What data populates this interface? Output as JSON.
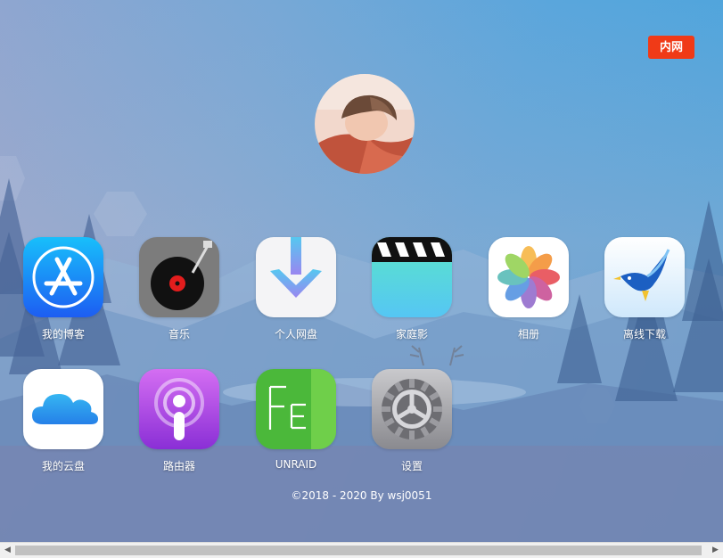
{
  "header": {
    "intranet_label": "内网"
  },
  "apps": [
    {
      "label": "我的博客",
      "icon": "app-store-icon"
    },
    {
      "label": "音乐",
      "icon": "record-player-icon"
    },
    {
      "label": "个人网盘",
      "icon": "download-arrow-icon"
    },
    {
      "label": "家庭影",
      "icon": "clapperboard-icon"
    },
    {
      "label": "相册",
      "icon": "photos-flower-icon"
    },
    {
      "label": "离线下载",
      "icon": "bird-icon"
    },
    {
      "label": "我的云盘",
      "icon": "cloud-icon"
    },
    {
      "label": "路由器",
      "icon": "podcast-icon"
    },
    {
      "label": "UNRAID",
      "icon": "fe-icon"
    },
    {
      "label": "设置",
      "icon": "gear-icon"
    }
  ],
  "footer": {
    "copyright": "©2018 - 2020 By wsj0051"
  },
  "colors": {
    "intranet_button": "#f03a17",
    "label_text": "#ffffff"
  }
}
